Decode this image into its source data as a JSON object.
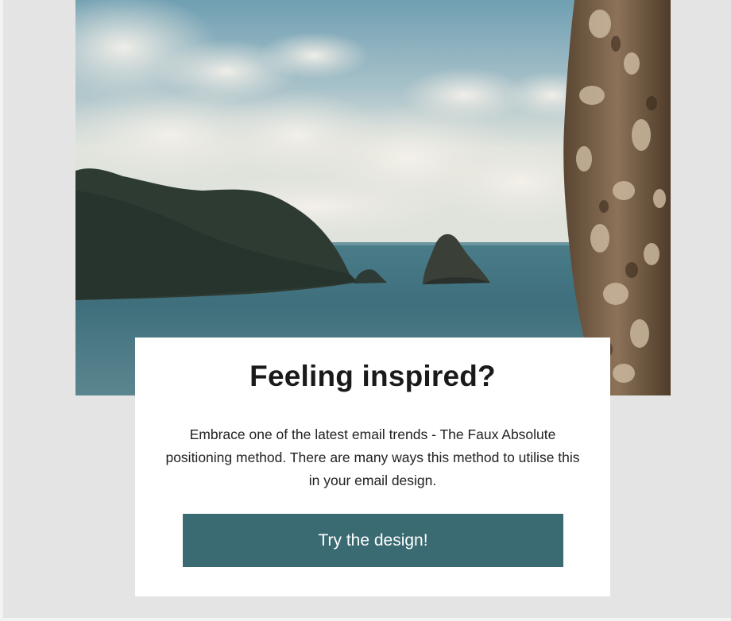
{
  "hero": {
    "image": "coastal-island-sea-clouds-with-tree-bark"
  },
  "card": {
    "title": "Feeling inspired?",
    "body": "Embrace one of the latest email trends - The Faux Absolute positioning method. There are many ways this method to utilise this in your email design.",
    "button_label": "Try the design!"
  },
  "colors": {
    "background": "#e4e4e4",
    "card": "#ffffff",
    "button": "#3b6b72",
    "button_text": "#ffffff",
    "title": "#1a1a1a"
  }
}
